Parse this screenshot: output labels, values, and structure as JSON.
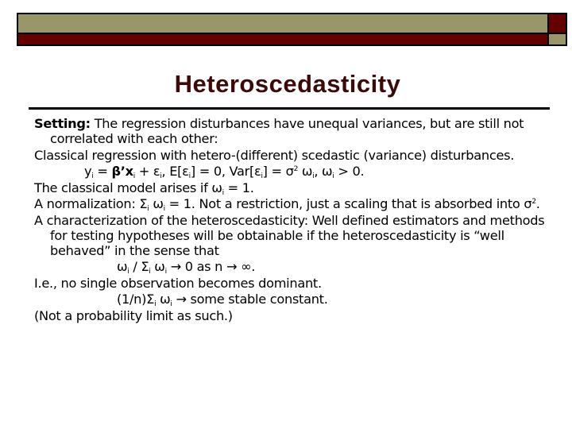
{
  "slide": {
    "title": "Heteroscedasticity",
    "colors": {
      "olive": "#99966a",
      "maroon": "#650000",
      "title": "#3d0a0a"
    },
    "setting": {
      "label": "Setting:",
      "text": "  The regression disturbances have unequal variances, but are still not correlated with each other:"
    },
    "classical": "Classical regression with hetero-(different) scedastic (variance) disturbances.",
    "equation": {
      "y": "y",
      "sub_i": "i",
      "eq1": " = ",
      "beta_x": "β’x",
      "plus": " + ε",
      "comma1": ",  E[ε",
      "close1": "]  =  0,  Var[ε",
      "close2": "]  =  σ",
      "sq": "2",
      "omega": " ω",
      "comma2": ", ω",
      "gt": " > 0."
    },
    "classical_model": {
      "text": "The classical model arises if ω",
      "sub": "i",
      "rest": " = 1."
    },
    "normalization": {
      "a": "A normalization:  Σ",
      "sub1": "i",
      "b": " ω",
      "sub2": "i",
      "c": " = 1.  Not a restriction, just a scaling that is absorbed into σ",
      "sq": "2",
      "d": "."
    },
    "characterization": "A characterization of the heteroscedasticity:  Well defined estimators and methods for testing hypotheses will be obtainable if the heteroscedasticity is “well behaved” in the sense that",
    "limit": {
      "a": "ω",
      "sub1": "i",
      "b": "  / Σ",
      "sub2": "i",
      "c": " ω",
      "sub3": "i",
      "d": "  → 0  as  n → ∞."
    },
    "ie": "I.e., no single observation becomes dominant.",
    "stable": {
      "a": "(1/n)Σ",
      "sub1": "i",
      "b": " ω",
      "sub2": "i",
      "c": "  → some stable constant."
    },
    "note": "(Not a probability limit as such.)"
  }
}
